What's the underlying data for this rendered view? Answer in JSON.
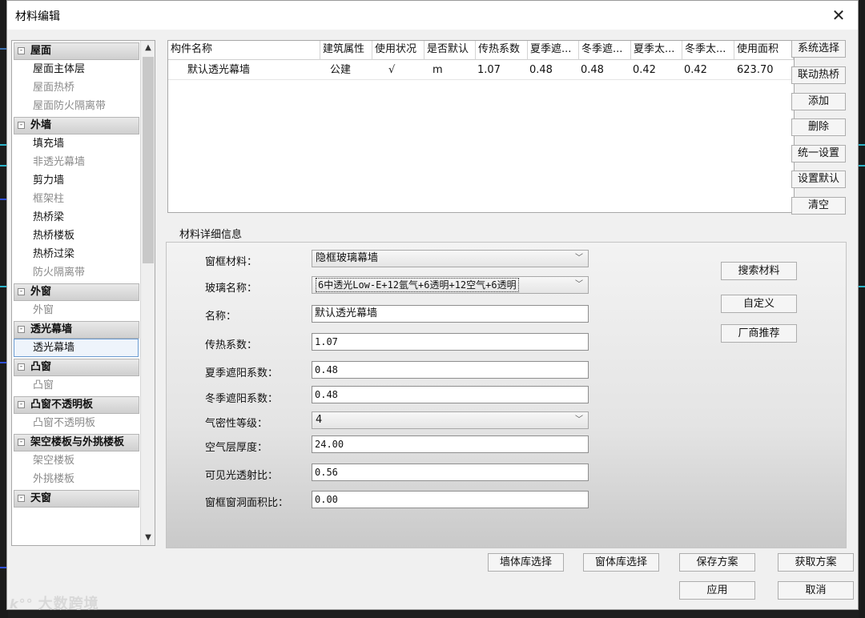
{
  "dialog": {
    "title": "材料编辑",
    "close_glyph": "✕"
  },
  "tree": {
    "categories": [
      {
        "label": "屋面",
        "items": [
          {
            "label": "屋面主体层",
            "enabled": true
          },
          {
            "label": "屋面热桥",
            "enabled": false
          },
          {
            "label": "屋面防火隔离带",
            "enabled": false
          }
        ]
      },
      {
        "label": "外墙",
        "items": [
          {
            "label": "填充墙",
            "enabled": true
          },
          {
            "label": "非透光幕墙",
            "enabled": false
          },
          {
            "label": "剪力墙",
            "enabled": true
          },
          {
            "label": "框架柱",
            "enabled": false
          },
          {
            "label": "热桥梁",
            "enabled": true
          },
          {
            "label": "热桥楼板",
            "enabled": true
          },
          {
            "label": "热桥过梁",
            "enabled": true
          },
          {
            "label": "防火隔离带",
            "enabled": false
          }
        ]
      },
      {
        "label": "外窗",
        "items": [
          {
            "label": "外窗",
            "enabled": false
          }
        ]
      },
      {
        "label": "透光幕墙",
        "items": [
          {
            "label": "透光幕墙",
            "enabled": true,
            "selected": true
          }
        ]
      },
      {
        "label": "凸窗",
        "items": [
          {
            "label": "凸窗",
            "enabled": false
          }
        ]
      },
      {
        "label": "凸窗不透明板",
        "items": [
          {
            "label": "凸窗不透明板",
            "enabled": false
          }
        ]
      },
      {
        "label": "架空楼板与外挑楼板",
        "items": [
          {
            "label": "架空楼板",
            "enabled": false
          },
          {
            "label": "外挑楼板",
            "enabled": false
          }
        ]
      },
      {
        "label": "天窗",
        "items": []
      }
    ],
    "collapse_glyph": "-",
    "scroll_up": "▲",
    "scroll_down": "▼"
  },
  "table": {
    "columns": [
      "构件名称",
      "建筑属性",
      "使用状况",
      "是否默认",
      "传热系数",
      "夏季遮...",
      "冬季遮...",
      "夏季太...",
      "冬季太...",
      "使用面积"
    ],
    "rows": [
      [
        "默认透光幕墙",
        "公建",
        "√",
        "m",
        "1.07",
        "0.48",
        "0.48",
        "0.42",
        "0.42",
        "623.70"
      ]
    ]
  },
  "side_buttons": [
    "系统选择",
    "联动热桥",
    "添加",
    "删除",
    "统一设置",
    "设置默认",
    "清空"
  ],
  "detail": {
    "section_title": "材料详细信息",
    "frame_material": {
      "label": "窗框材料：",
      "value": "隐框玻璃幕墙"
    },
    "glass_name": {
      "label": "玻璃名称：",
      "value": "6中透光Low-E+12氩气+6透明+12空气+6透明"
    },
    "name": {
      "label": "名称：",
      "value": "默认透光幕墙"
    },
    "u_value": {
      "label": "传热系数：",
      "value": "1.07"
    },
    "summer_shading": {
      "label": "夏季遮阳系数：",
      "value": "0.48"
    },
    "winter_shading": {
      "label": "冬季遮阳系数：",
      "value": "0.48"
    },
    "airtightness": {
      "label": "气密性等级：",
      "value": "4"
    },
    "air_gap": {
      "label": "空气层厚度：",
      "value": "24.00"
    },
    "visible_transmittance": {
      "label": "可见光透射比：",
      "value": "0.56"
    },
    "frame_ratio": {
      "label": "窗框窗洞面积比：",
      "value": "0.00"
    },
    "search_button": "搜索材料",
    "custom_button": "自定义",
    "vendor_button": "厂商推荐"
  },
  "bottom_buttons": {
    "wall_lib": "墙体库选择",
    "window_lib": "窗体库选择",
    "save_scheme": "保存方案",
    "get_scheme": "获取方案",
    "apply": "应用",
    "cancel": "取消"
  },
  "watermark": {
    "logo": "k°°",
    "text": "大数跨境"
  },
  "chevron_glyph": "﹀"
}
